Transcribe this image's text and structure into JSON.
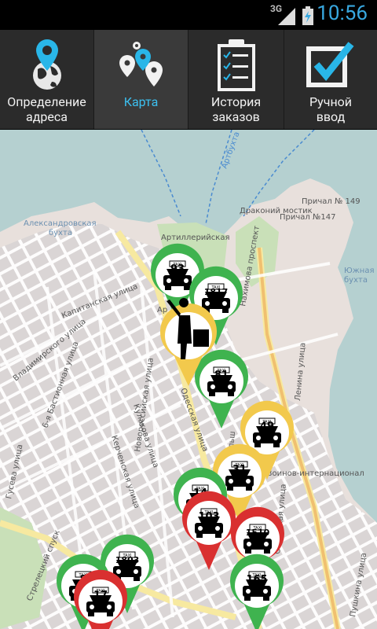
{
  "status": {
    "network": "3G",
    "time": "10:56"
  },
  "tabs": [
    {
      "label_line1": "Определение",
      "label_line2": "адреса",
      "icon": "globe-pin-icon"
    },
    {
      "label_line1": "Карта",
      "label_line2": "",
      "icon": "map-pins-icon"
    },
    {
      "label_line1": "История",
      "label_line2": "заказов",
      "icon": "clipboard-list-icon"
    },
    {
      "label_line1": "Ручной",
      "label_line2": "ввод",
      "icon": "checkbox-icon"
    }
  ],
  "map_labels": {
    "bay1": "Александровская",
    "bay1b": "бухта",
    "bay2": "Южная",
    "bay2b": "бухта",
    "artill": "Артиллерийская",
    "artbukhta": "Артбухта",
    "dramatic": "Драконий мостик",
    "pier149": "Причал № 149",
    "pier147": "Причал №147",
    "prospekt": "Нахимова проспект",
    "kapital": "Капитанская улица",
    "lenina": "Ленина улица",
    "odesskaya": "Одесская улица",
    "kulakova": "Кулакова улица",
    "novorossiyskaya": "Новороссийская улица",
    "kerchenskaya": "Керченская улица",
    "gusheva": "Гусева улица",
    "streletsky": "Стрелецкий спуск",
    "sever": "Сквер Воинов-интернационал",
    "sovetskaya": "Советская улица",
    "pushkina": "Пушкина улица",
    "vladimirskogo": "Владимирского улица",
    "bastion": "6-я Бастионная улица",
    "bolsh": "Больш",
    "art_short": "Ар"
  },
  "markers": [
    {
      "number": "93",
      "color": "#3fb34f"
    },
    {
      "number": "1817",
      "color": "#3fb34f"
    },
    {
      "number": "81",
      "color": "#3fb34f"
    },
    {
      "number": "49",
      "color": "#f2c94c"
    },
    {
      "number": "31",
      "color": "#f2c94c"
    },
    {
      "number": "14",
      "color": "#3fb34f"
    },
    {
      "number": "103",
      "color": "#d93030"
    },
    {
      "number": "1510",
      "color": "#d93030"
    },
    {
      "number": "165",
      "color": "#3fb34f"
    },
    {
      "number": "1803",
      "color": "#3fb34f"
    },
    {
      "number": "8",
      "color": "#3fb34f"
    },
    {
      "number": "17",
      "color": "#d93030"
    }
  ],
  "user_marker": {
    "color": "#f2c94c"
  },
  "taxi_sign": "TAXI"
}
